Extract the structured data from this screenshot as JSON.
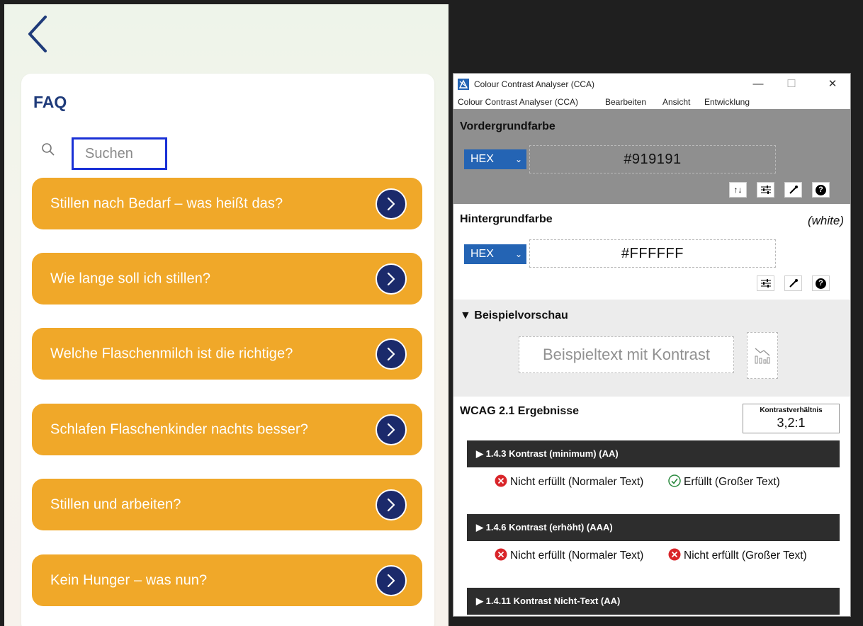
{
  "faq": {
    "title": "FAQ",
    "search_placeholder": "Suchen",
    "items": [
      {
        "label": "Stillen nach Bedarf – was heißt das?"
      },
      {
        "label": "Wie lange soll ich stillen?"
      },
      {
        "label": "Welche Flaschenmilch ist die richtige?"
      },
      {
        "label": "Schlafen Flaschenkinder nachts besser?"
      },
      {
        "label": "Stillen und arbeiten?"
      },
      {
        "label": "Kein Hunger – was nun?"
      }
    ]
  },
  "cca": {
    "window_title": "Colour Contrast Analyser (CCA)",
    "controls": {
      "minimize": "—",
      "maximize": "☐",
      "close": "✕"
    },
    "menu": [
      "Colour Contrast Analyser (CCA)",
      "Bearbeiten",
      "Ansicht",
      "Entwicklung"
    ],
    "foreground": {
      "title": "Vordergrundfarbe",
      "format": "HEX",
      "value": "#919191",
      "swap_label": "↑↓",
      "help_label": "?"
    },
    "background": {
      "title": "Hintergrundfarbe",
      "color_name": "(white)",
      "format": "HEX",
      "value": "#FFFFFF",
      "help_label": "?"
    },
    "preview": {
      "title": "▼ Beispielvorschau",
      "sample_text": "Beispieltext mit Kontrast"
    },
    "results": {
      "title": "WCAG 2.1 Ergebnisse",
      "ratio_label": "Kontrastverhältnis",
      "ratio_value": "3,2:1",
      "criteria": [
        {
          "title": "▶ 1.4.3 Kontrast (minimum) (AA)",
          "normal": "Nicht erfüllt (Normaler Text)",
          "normal_pass": false,
          "large": "Erfüllt (Großer Text)",
          "large_pass": true
        },
        {
          "title": "▶ 1.4.6 Kontrast (erhöht) (AAA)",
          "normal": "Nicht erfüllt (Normaler Text)",
          "normal_pass": false,
          "large": "Nicht erfüllt (Großer Text)",
          "large_pass": false
        },
        {
          "title": "▶ 1.4.11 Kontrast Nicht-Text (AA)"
        }
      ]
    }
  },
  "colors": {
    "faq_item": "#f0a829",
    "faq_arrow": "#1b2a6b",
    "faq_title": "#1f3b7a",
    "search_focus": "#1a31d6",
    "select_blue": "#2464b4",
    "fail_red": "#d9252a",
    "pass_green": "#2a8a3e"
  }
}
